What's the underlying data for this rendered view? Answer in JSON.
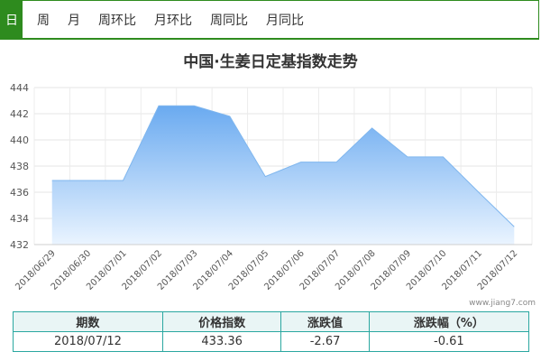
{
  "tabs": [
    {
      "label": "日",
      "active": true
    },
    {
      "label": "周"
    },
    {
      "label": "月"
    },
    {
      "label": "周环比"
    },
    {
      "label": "月环比"
    },
    {
      "label": "周同比"
    },
    {
      "label": "月同比"
    }
  ],
  "colors": {
    "accent": "#2e8b1e",
    "area_top": "#6aaaf0",
    "area_bottom": "#eaf4ff",
    "line": "#7fb6ee",
    "table_border": "#2aa7a0"
  },
  "watermark": "www.jiang7.com",
  "chart_data": {
    "type": "area",
    "title": "中国·生姜日定基指数走势",
    "xlabel": "",
    "ylabel": "",
    "x": [
      "2018/06/29",
      "2018/06/30",
      "2018/07/01",
      "2018/07/02",
      "2018/07/03",
      "2018/07/04",
      "2018/07/05",
      "2018/07/06",
      "2018/07/07",
      "2018/07/08",
      "2018/07/09",
      "2018/07/10",
      "2018/07/11",
      "2018/07/12"
    ],
    "series": [
      {
        "values": [
          436.9,
          436.9,
          436.9,
          442.6,
          442.6,
          441.8,
          437.2,
          438.3,
          438.3,
          440.9,
          438.7,
          438.7,
          436.0,
          433.36
        ]
      }
    ],
    "ylim": [
      432,
      444
    ],
    "yticks": [
      432,
      434,
      436,
      438,
      440,
      442,
      444
    ],
    "grid": true,
    "legend": "none"
  },
  "table": {
    "headers": [
      "期数",
      "价格指数",
      "涨跌值",
      "涨跌幅（%）"
    ],
    "rows": [
      [
        "2018/07/12",
        "433.36",
        "-2.67",
        "-0.61"
      ]
    ]
  }
}
